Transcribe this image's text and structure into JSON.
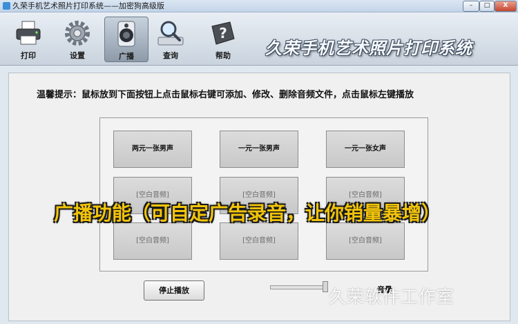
{
  "window": {
    "title": "久荣手机艺术照片打印系统——加密狗高级版",
    "minimize": "–",
    "maximize": "□",
    "close": "X"
  },
  "toolbar": {
    "print": "打印",
    "settings": "设置",
    "broadcast": "广播",
    "query": "查询",
    "help": "帮助",
    "brand_title": "久荣手机艺术照片打印系统"
  },
  "hint": "温馨提示：鼠标放到下面按钮上点击鼠标右键可添加、修改、删除音频文件，点击鼠标左键播放",
  "sounds": [
    "两元一张男声",
    "一元一张男声",
    "一元一张女声",
    "[空白音频]",
    "[空白音频]",
    "[空白音频]",
    "[空白音频]",
    "[空白音频]",
    "[空白音频]"
  ],
  "stop_label": "停止播放",
  "volume_label": "音量",
  "overlay_caption": "广播功能（可自定广告录音，让你销量暴增）",
  "watermark": "久荣软件工作室"
}
